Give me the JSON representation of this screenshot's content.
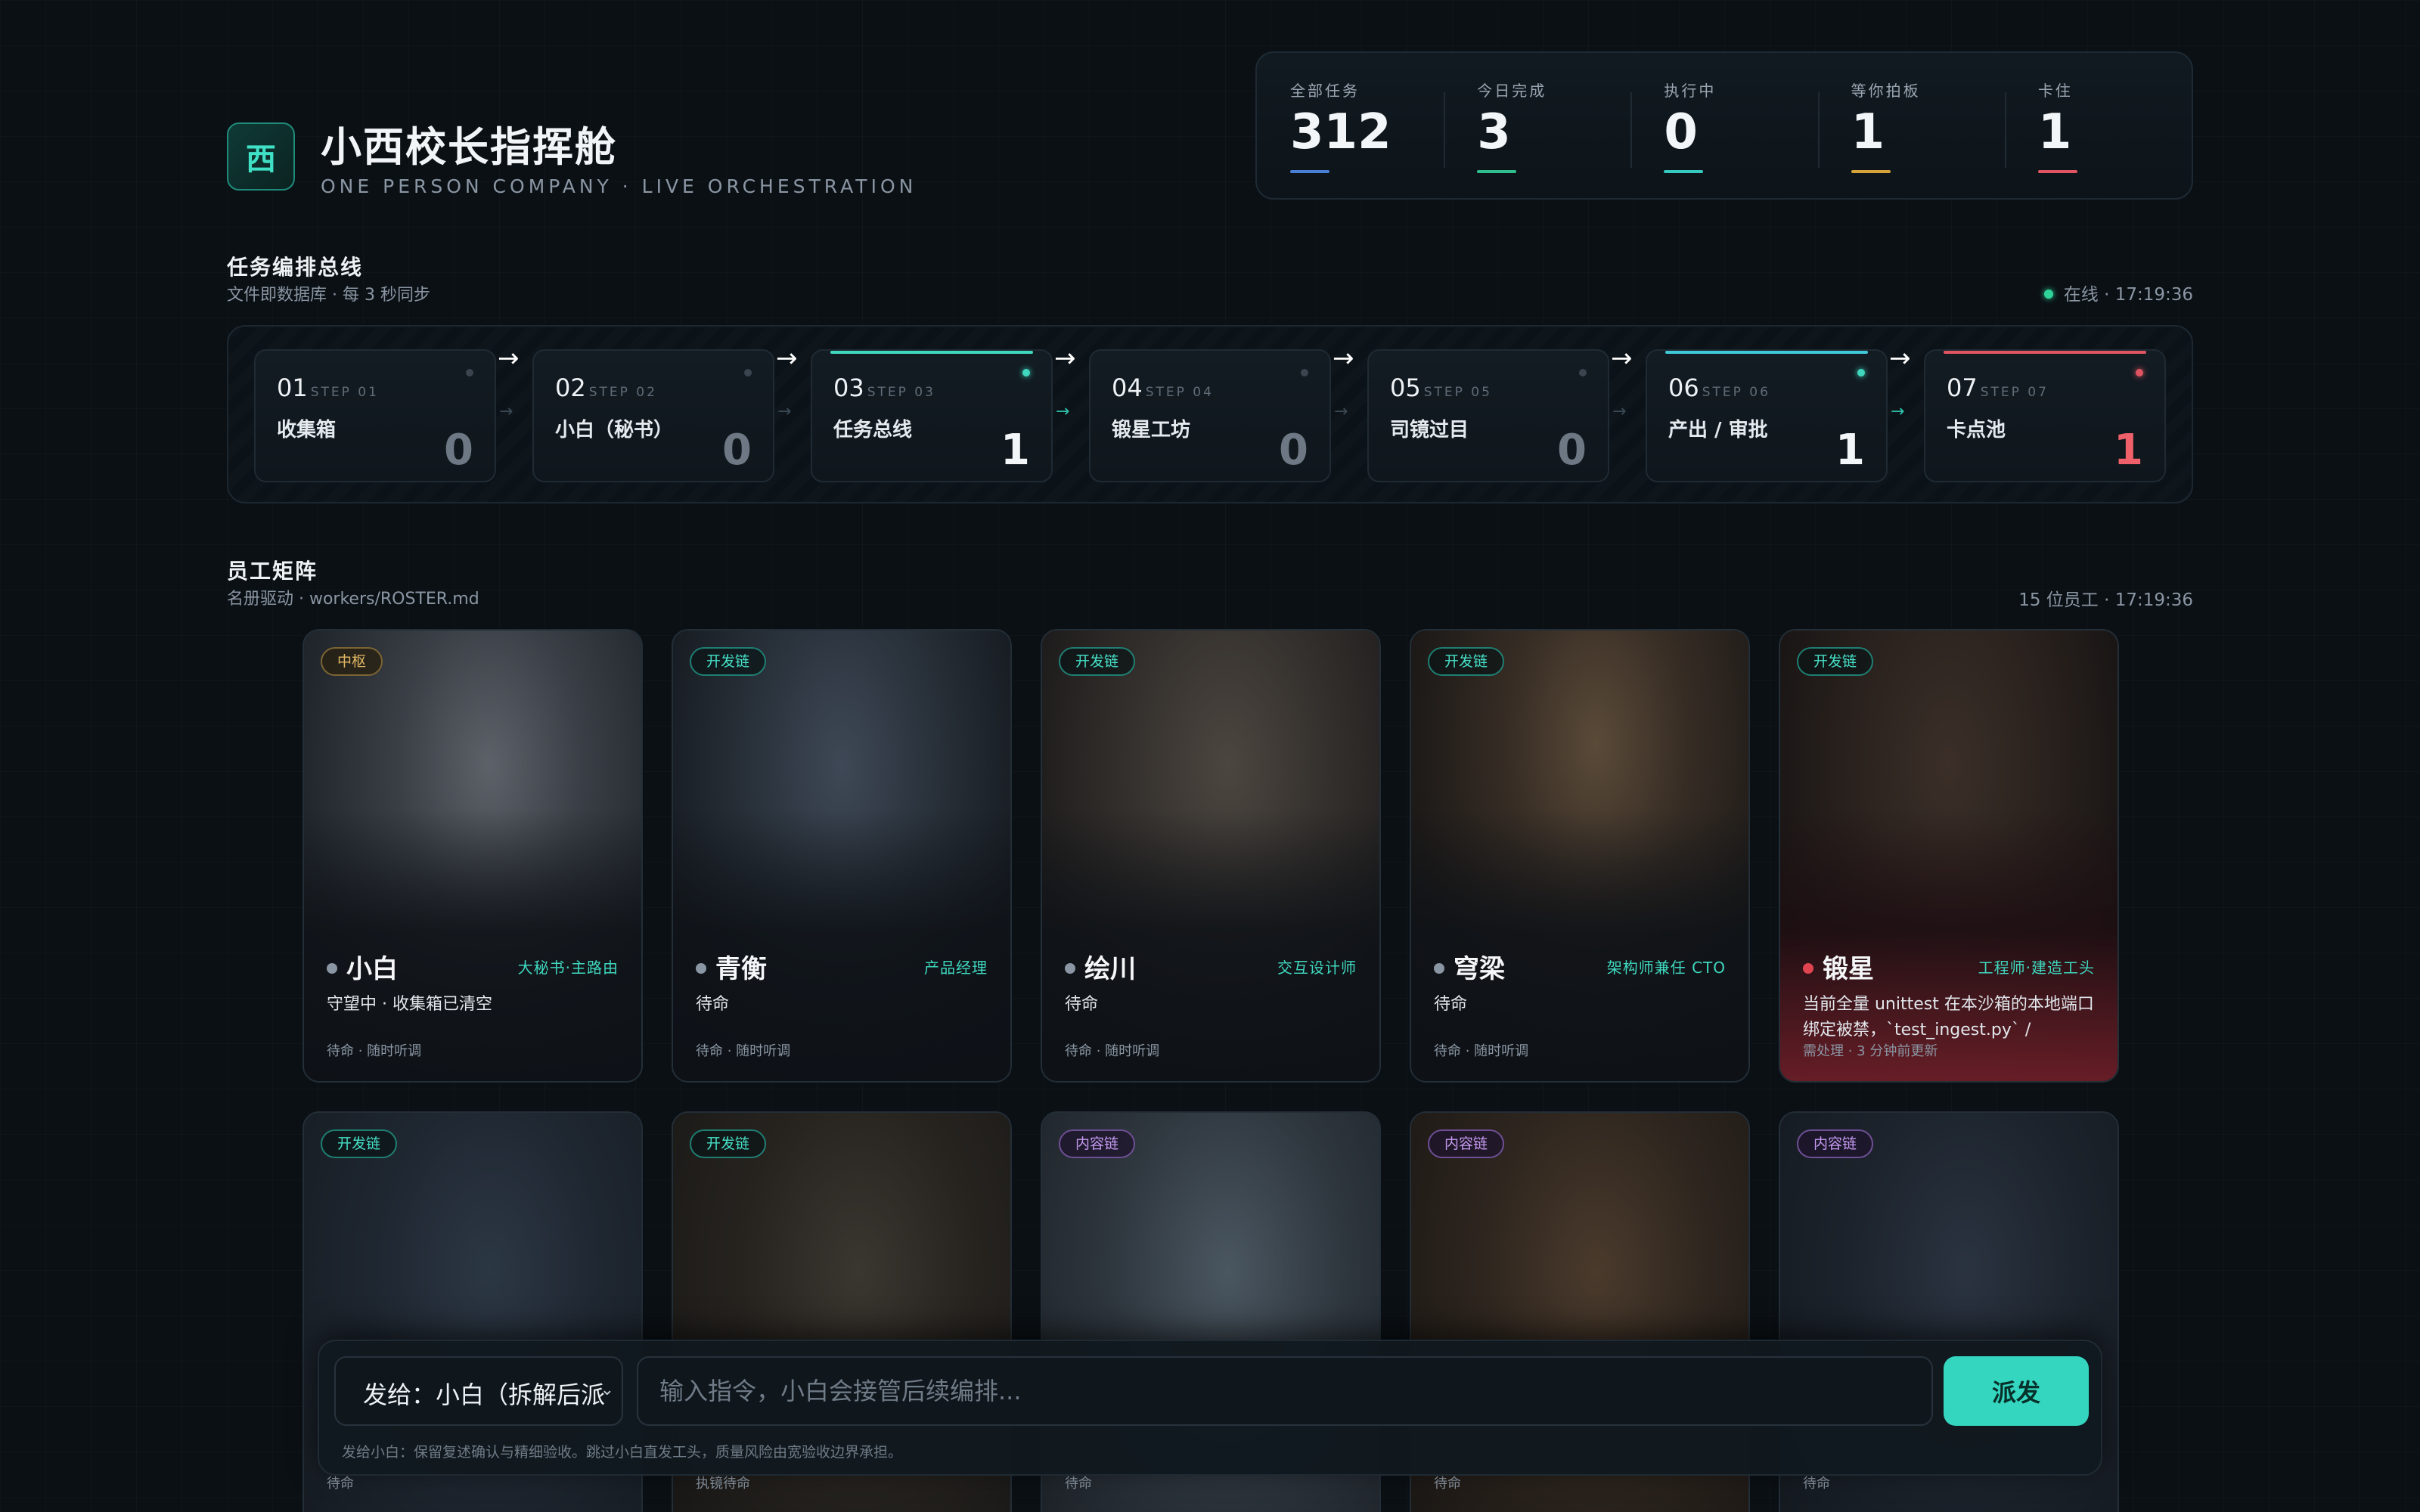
{
  "header": {
    "logo_char": "西",
    "title": "小西校长指挥舱",
    "subtitle": "ONE PERSON COMPANY · LIVE ORCHESTRATION"
  },
  "stats": [
    {
      "label": "全部任务",
      "value": "312",
      "color": "#4a7fd6"
    },
    {
      "label": "今日完成",
      "value": "3",
      "color": "#2fbf8f"
    },
    {
      "label": "执行中",
      "value": "0",
      "color": "#35c9c0"
    },
    {
      "label": "等你拍板",
      "value": "1",
      "color": "#d6a33a"
    },
    {
      "label": "卡住",
      "value": "1",
      "color": "#e05561"
    }
  ],
  "pipeline": {
    "title": "任务编排总线",
    "subtitle": "文件即数据库 · 每 3 秒同步",
    "status": "在线 · 17:19:36",
    "steps": [
      {
        "num": "01",
        "tag": "STEP 01",
        "name": "收集箱",
        "count": "0"
      },
      {
        "num": "02",
        "tag": "STEP 02",
        "name": "小白（秘书）",
        "count": "0"
      },
      {
        "num": "03",
        "tag": "STEP 03",
        "name": "任务总线",
        "count": "1"
      },
      {
        "num": "04",
        "tag": "STEP 04",
        "name": "锻星工坊",
        "count": "0"
      },
      {
        "num": "05",
        "tag": "STEP 05",
        "name": "司镜过目",
        "count": "0"
      },
      {
        "num": "06",
        "tag": "STEP 06",
        "name": "产出 / 审批",
        "count": "1"
      },
      {
        "num": "07",
        "tag": "STEP 07",
        "name": "卡点池",
        "count": "1"
      }
    ]
  },
  "roster": {
    "title": "员工矩阵",
    "subtitle": "名册驱动 · workers/ROSTER.md",
    "count": "15 位员工 · 17:19:36",
    "workers": [
      {
        "badge": "中枢",
        "name": "小白",
        "role": "大秘书·主路由",
        "status": "守望中 · 收集箱已清空",
        "foot": "待命 · 随时听调"
      },
      {
        "badge": "开发链",
        "name": "青衡",
        "role": "产品经理",
        "status": "待命",
        "foot": "待命 · 随时听调"
      },
      {
        "badge": "开发链",
        "name": "绘川",
        "role": "交互设计师",
        "status": "待命",
        "foot": "待命 · 随时听调"
      },
      {
        "badge": "开发链",
        "name": "穹梁",
        "role": "架构师兼任 CTO",
        "status": "待命",
        "foot": "待命 · 随时听调"
      },
      {
        "badge": "开发链",
        "name": "锻星",
        "role": "工程师·建造工头",
        "status": "当前全量 unittest 在本沙箱的本地端口绑定被禁，`test_ingest.py` /",
        "foot": "需处理 · 3 分钟前更新"
      },
      {
        "badge": "开发链",
        "foot": "待命"
      },
      {
        "badge": "开发链",
        "foot": "执镜待命"
      },
      {
        "badge": "内容链",
        "foot": "待命"
      },
      {
        "badge": "内容链",
        "foot": "待命"
      },
      {
        "badge": "内容链",
        "foot": "待命"
      }
    ]
  },
  "command": {
    "target": "发给：小白（拆解后派",
    "placeholder": "输入指令，小白会接管后续编排...",
    "send": "派发",
    "hint": "发给小白：保留复述确认与精细验收。跳过小白直发工头，质量风险由宽验收边界承担。"
  }
}
